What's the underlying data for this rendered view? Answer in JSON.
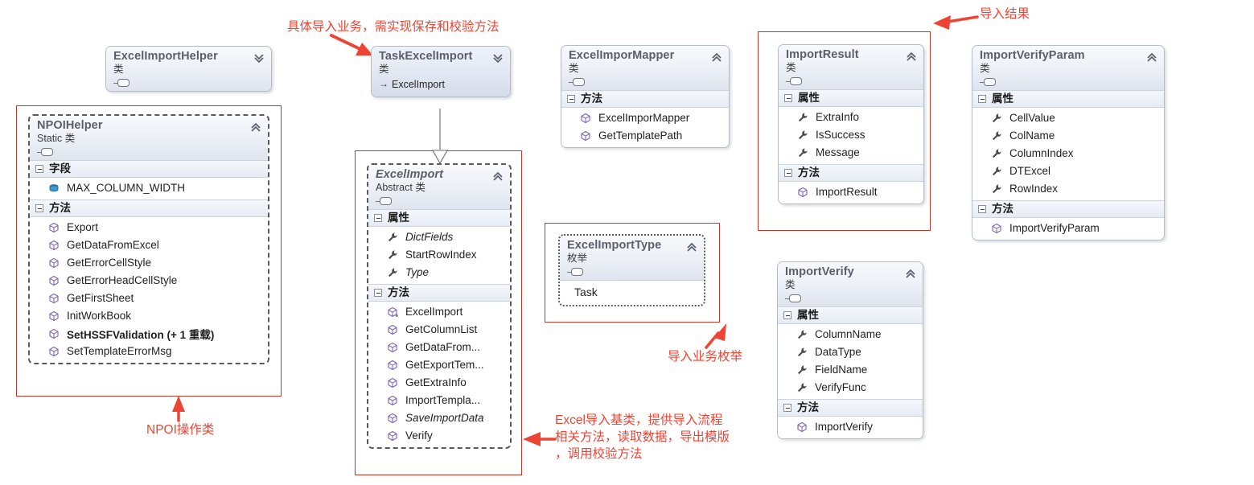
{
  "diagram": {
    "title": "Excel Import UML Class Diagram",
    "accent_red": "#ee4433",
    "frame_red": "#c0392b"
  },
  "icons": {
    "collapse": "chevron-up-icon",
    "expand": "chevron-down-icon",
    "property": "wrench-icon",
    "method": "method-cube-icon",
    "field": "field-cylinder-icon",
    "interface_lollipop": "lollipop-icon",
    "expander": "collapse-toggle-icon"
  },
  "boxes": {
    "excel_import_helper": {
      "title": "ExcelImportHelper",
      "stereotype": "类",
      "chevron": "expand"
    },
    "npoi_helper": {
      "title": "NPOIHelper",
      "stereotype": "Static 类",
      "chevron": "collapse",
      "sections": [
        {
          "label": "字段",
          "kind": "field",
          "members": [
            {
              "name": "MAX_COLUMN_WIDTH",
              "style": "normal"
            }
          ]
        },
        {
          "label": "方法",
          "kind": "method",
          "members": [
            {
              "name": "Export",
              "style": "normal"
            },
            {
              "name": "GetDataFromExcel",
              "style": "normal"
            },
            {
              "name": "GetErrorCellStyle",
              "style": "normal"
            },
            {
              "name": "GetErrorHeadCellStyle",
              "style": "normal"
            },
            {
              "name": "GetFirstSheet",
              "style": "normal"
            },
            {
              "name": "InitWorkBook",
              "style": "normal"
            },
            {
              "name": "SetHSSFValidation (+ 1 重载)",
              "style": "bold"
            },
            {
              "name": "SetTemplateErrorMsg",
              "style": "normal"
            }
          ]
        }
      ]
    },
    "task_excel_import": {
      "title": "TaskExcelImport",
      "stereotype": "类",
      "base": "ExcelImport",
      "chevron": "expand"
    },
    "excel_import": {
      "title": "ExcelImport",
      "stereotype": "Abstract 类",
      "chevron": "collapse",
      "sections": [
        {
          "label": "属性",
          "kind": "property",
          "members": [
            {
              "name": "DictFields",
              "style": "italic"
            },
            {
              "name": "StartRowIndex",
              "style": "normal"
            },
            {
              "name": "Type",
              "style": "italic"
            }
          ]
        },
        {
          "label": "方法",
          "kind": "method",
          "members": [
            {
              "name": "ExcelImport",
              "style": "normal",
              "ctor": true
            },
            {
              "name": "GetColumnList",
              "style": "normal"
            },
            {
              "name": "GetDataFrom...",
              "style": "normal"
            },
            {
              "name": "GetExportTem...",
              "style": "normal"
            },
            {
              "name": "GetExtraInfo",
              "style": "normal"
            },
            {
              "name": "ImportTempla...",
              "style": "normal"
            },
            {
              "name": "SaveImportData",
              "style": "italic"
            },
            {
              "name": "Verify",
              "style": "normal"
            }
          ]
        }
      ]
    },
    "excel_impor_mapper": {
      "title": "ExcelImporMapper",
      "stereotype": "类",
      "chevron": "collapse",
      "sections": [
        {
          "label": "方法",
          "kind": "method",
          "members": [
            {
              "name": "ExcelImporMapper",
              "style": "normal"
            },
            {
              "name": "GetTemplatePath",
              "style": "normal"
            }
          ]
        }
      ]
    },
    "import_result": {
      "title": "ImportResult",
      "stereotype": "类",
      "chevron": "collapse",
      "sections": [
        {
          "label": "属性",
          "kind": "property",
          "members": [
            {
              "name": "ExtraInfo",
              "style": "normal"
            },
            {
              "name": "IsSuccess",
              "style": "normal"
            },
            {
              "name": "Message",
              "style": "normal"
            }
          ]
        },
        {
          "label": "方法",
          "kind": "method",
          "members": [
            {
              "name": "ImportResult",
              "style": "normal"
            }
          ]
        }
      ]
    },
    "import_verify_param": {
      "title": "ImportVerifyParam",
      "stereotype": "类",
      "chevron": "collapse",
      "sections": [
        {
          "label": "属性",
          "kind": "property",
          "members": [
            {
              "name": "CellValue",
              "style": "normal"
            },
            {
              "name": "ColName",
              "style": "normal"
            },
            {
              "name": "ColumnIndex",
              "style": "normal"
            },
            {
              "name": "DTExcel",
              "style": "normal"
            },
            {
              "name": "RowIndex",
              "style": "normal"
            }
          ]
        },
        {
          "label": "方法",
          "kind": "method",
          "members": [
            {
              "name": "ImportVerifyParam",
              "style": "normal"
            }
          ]
        }
      ]
    },
    "import_verify": {
      "title": "ImportVerify",
      "stereotype": "类",
      "chevron": "collapse",
      "sections": [
        {
          "label": "属性",
          "kind": "property",
          "members": [
            {
              "name": "ColumnName",
              "style": "normal"
            },
            {
              "name": "DataType",
              "style": "normal"
            },
            {
              "name": "FieldName",
              "style": "normal"
            },
            {
              "name": "VerifyFunc",
              "style": "normal"
            }
          ]
        },
        {
          "label": "方法",
          "kind": "method",
          "members": [
            {
              "name": "ImportVerify",
              "style": "normal"
            }
          ]
        }
      ]
    },
    "excel_import_type": {
      "title": "ExcelImportType",
      "stereotype": "枚举",
      "chevron": "collapse",
      "enum_members": [
        "Task"
      ]
    }
  },
  "annotations": {
    "task_note": "具体导入业务，需实现保存和校验方法",
    "result_note": "导入结果",
    "npoi_note": "NPOI操作类",
    "enum_note": "导入业务枚举",
    "base_note_line1": "Excel导入基类，提供导入流程",
    "base_note_line2": "相关方法，读取数据，导出模版",
    "base_note_line3": "，调用校验方法"
  }
}
